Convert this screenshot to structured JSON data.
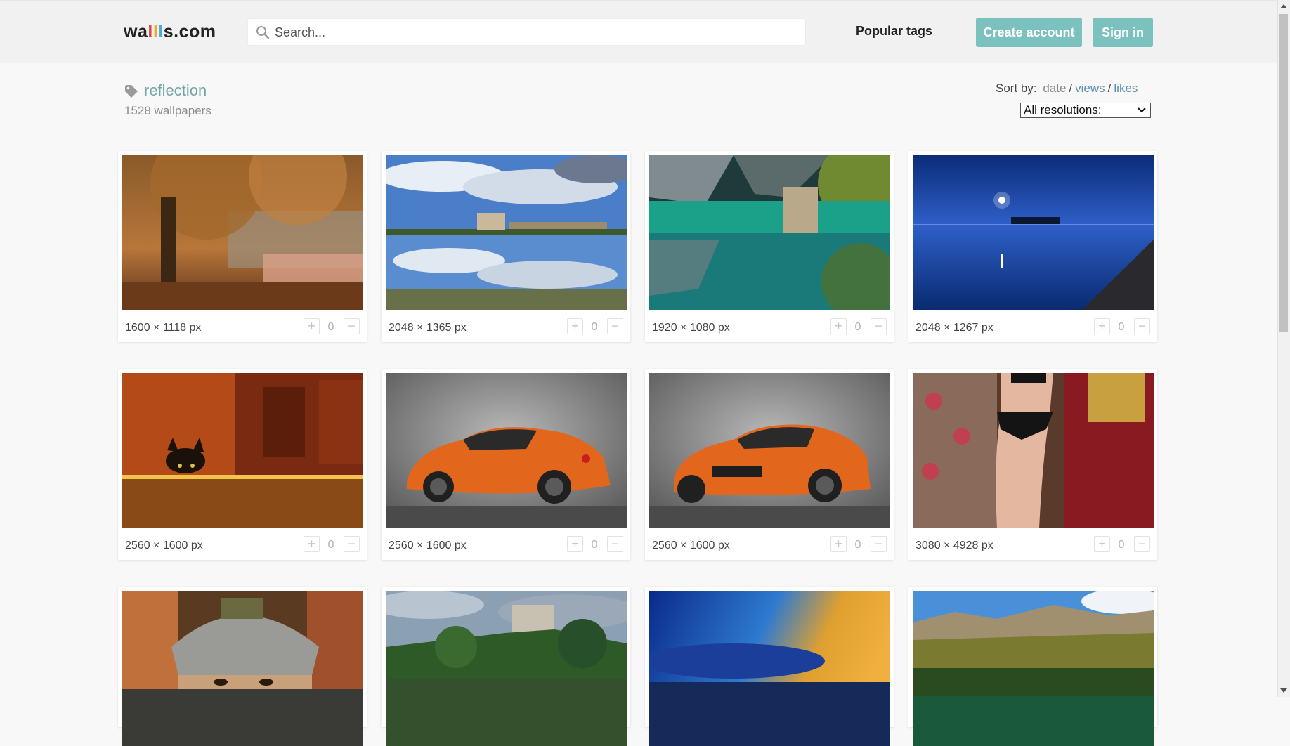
{
  "header": {
    "logo": {
      "part1": "wa",
      "a1": "l",
      "a2": "l",
      "a3": "l",
      "part2": "s.com"
    },
    "search_placeholder": "Search...",
    "popular_tags_label": "Popular tags",
    "create_account_label": "Create account",
    "sign_in_label": "Sign in",
    "brand_color": "#7bc1bd"
  },
  "tag": {
    "name": "reflection",
    "count_text": "1528 wallpapers"
  },
  "sort": {
    "label": "Sort by:",
    "options": [
      "date",
      "views",
      "likes"
    ],
    "active": "date",
    "separator": "/",
    "resolution_selected": "All resolutions:"
  },
  "wallpapers": [
    {
      "resolution": "1600 × 1118 px",
      "score": "0",
      "plus": "+",
      "minus": "−",
      "scene": "autumn-tree-lake"
    },
    {
      "resolution": "2048 × 1365 px",
      "score": "0",
      "plus": "+",
      "minus": "−",
      "scene": "castle-clouds-reflection"
    },
    {
      "resolution": "1920 × 1080 px",
      "score": "0",
      "plus": "+",
      "minus": "−",
      "scene": "emerald-mountain-lake"
    },
    {
      "resolution": "2048 × 1267 px",
      "score": "0",
      "plus": "+",
      "minus": "−",
      "scene": "night-sea-moon"
    },
    {
      "resolution": "2560 × 1600 px",
      "score": "0",
      "plus": "+",
      "minus": "−",
      "scene": "cat-peeking-table"
    },
    {
      "resolution": "2560 × 1600 px",
      "score": "0",
      "plus": "+",
      "minus": "−",
      "scene": "orange-car-rear"
    },
    {
      "resolution": "2560 × 1600 px",
      "score": "0",
      "plus": "+",
      "minus": "−",
      "scene": "orange-car-front"
    },
    {
      "resolution": "3080 × 4928 px",
      "score": "0",
      "plus": "+",
      "minus": "−",
      "scene": "woman-lingerie-mirror"
    },
    {
      "resolution": "",
      "score": "",
      "plus": "",
      "minus": "",
      "scene": "samurai-helmet"
    },
    {
      "resolution": "",
      "score": "",
      "plus": "",
      "minus": "",
      "scene": "castle-hill-forest"
    },
    {
      "resolution": "",
      "score": "",
      "plus": "",
      "minus": "",
      "scene": "blue-orange-sky"
    },
    {
      "resolution": "",
      "score": "",
      "plus": "",
      "minus": "",
      "scene": "mountain-meadow-lake"
    }
  ]
}
